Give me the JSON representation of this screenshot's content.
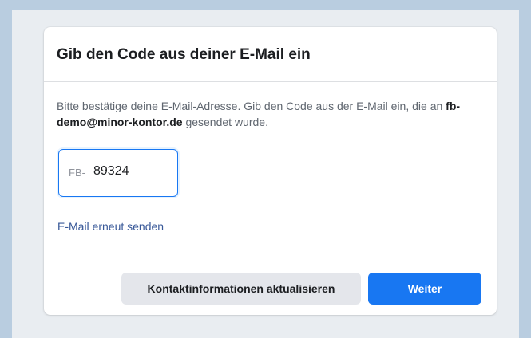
{
  "dialog": {
    "title": "Gib den Code aus deiner E-Mail ein",
    "description_before": "Bitte bestätige deine E-Mail-Adresse. Gib den Code aus der E-Mail ein, die an ",
    "email": "fb-demo@minor-kontor.de",
    "description_after": " gesendet wurde.",
    "code_prefix": "FB-",
    "code_value": "89324",
    "resend_label": "E-Mail erneut senden",
    "update_contact_label": "Kontaktinformationen aktualisieren",
    "continue_label": "Weiter"
  },
  "colors": {
    "outer_border": "#b9cde0",
    "page_background": "#e9edf1",
    "primary": "#1877f2",
    "link": "#385898",
    "secondary_button": "#e4e6eb"
  }
}
